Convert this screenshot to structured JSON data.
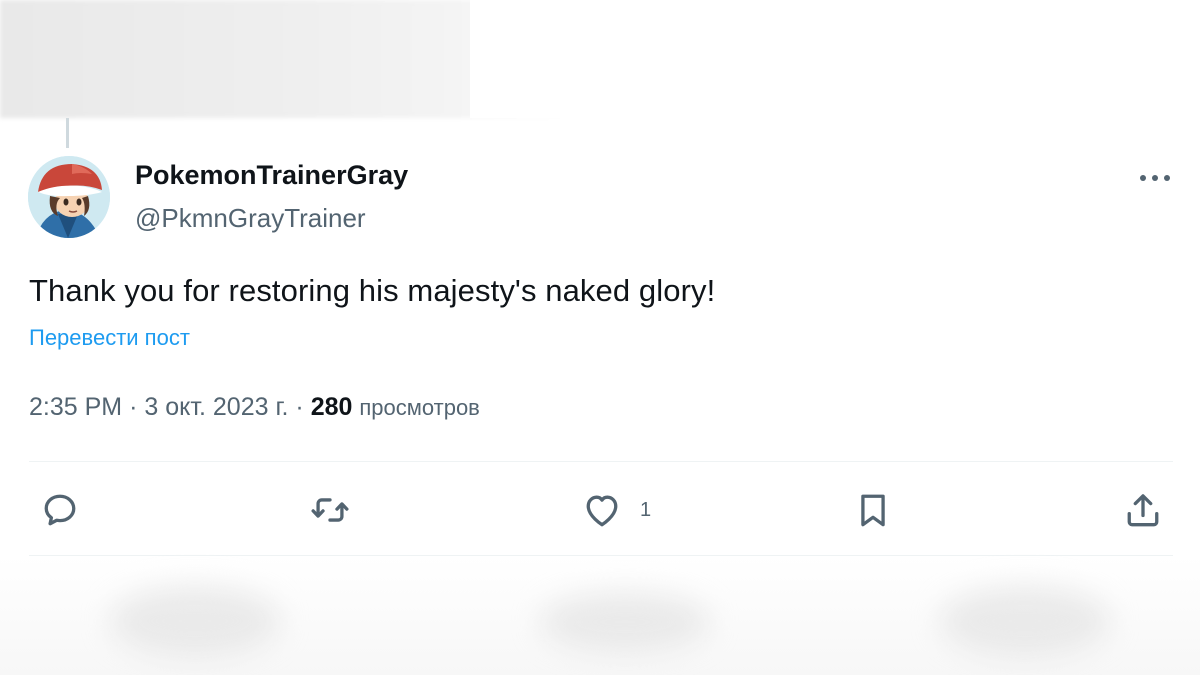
{
  "tweet": {
    "display_name": "PokemonTrainerGray",
    "handle": "@PkmnGrayTrainer",
    "text": "Thank you for restoring his majesty's naked glory!",
    "translate_label": "Перевести пост",
    "time": "2:35 PM",
    "separator": "·",
    "date": "3 окт. 2023 г.",
    "views_count": "280",
    "views_label": "просмотров"
  },
  "actions": {
    "reply_count": "",
    "retweet_count": "",
    "like_count": "1",
    "icons": [
      "reply-icon",
      "retweet-icon",
      "like-icon",
      "bookmark-icon",
      "share-icon"
    ]
  },
  "colors": {
    "text_primary": "#0f1419",
    "text_secondary": "#536471",
    "link": "#1d9bf0",
    "divider": "#eff3f4"
  }
}
